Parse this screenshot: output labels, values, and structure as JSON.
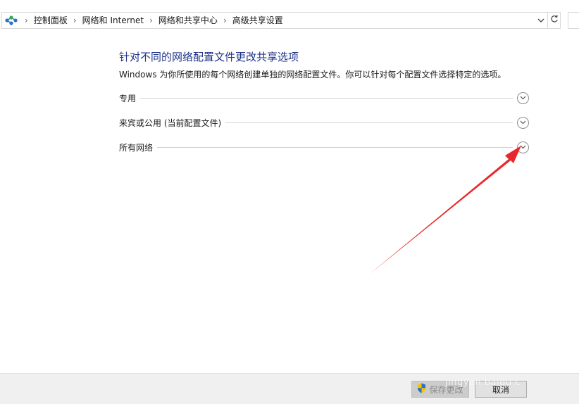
{
  "breadcrumb": [
    "控制面板",
    "网络和 Internet",
    "网络和共享中心",
    "高级共享设置"
  ],
  "page": {
    "title": "针对不同的网络配置文件更改共享选项",
    "description": "Windows 为你所使用的每个网络创建单独的网络配置文件。你可以针对每个配置文件选择特定的选项。"
  },
  "sections": [
    {
      "label": "专用"
    },
    {
      "label": "来宾或公用 (当前配置文件)"
    },
    {
      "label": "所有网络"
    }
  ],
  "footer": {
    "save_label": "保存更改",
    "cancel_label": "取消"
  },
  "watermark": "jingyan.baidu.c",
  "icons": {
    "app": "network-sharing-icon",
    "separator": "chevron-right-icon",
    "dropdown": "chevron-down-icon",
    "refresh": "refresh-icon",
    "expand": "chevron-down-circle-icon",
    "shield": "uac-shield-icon"
  },
  "colors": {
    "title": "#1e3287",
    "annotation_arrow": "#e8292b"
  }
}
